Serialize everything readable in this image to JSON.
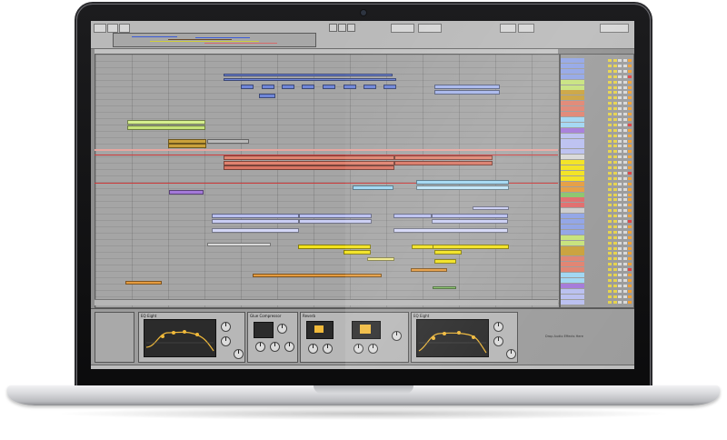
{
  "devices": {
    "eq_left_title": "EQ Eight",
    "comp_title": "Glue Compressor",
    "reverb_title": "Reverb",
    "eq_right_title": "EQ Eight",
    "drop_hint": "Drop Audio Effects Here"
  },
  "icons": [
    "camera-dot",
    "eq-curve-icon",
    "knob-icon"
  ],
  "colors": {
    "clip_blue": "#6f86d8",
    "clip_green": "#c6e27a",
    "clip_gold": "#c9a13a",
    "clip_salmon": "#e0826f",
    "clip_yellow": "#f2e21a",
    "clip_orange": "#e59b3e",
    "clip_lavender": "#b9bff0",
    "clip_skyblue": "#9fd6f2",
    "clip_purple": "#a479d9",
    "clip_lightyellow": "#f1ea88"
  }
}
